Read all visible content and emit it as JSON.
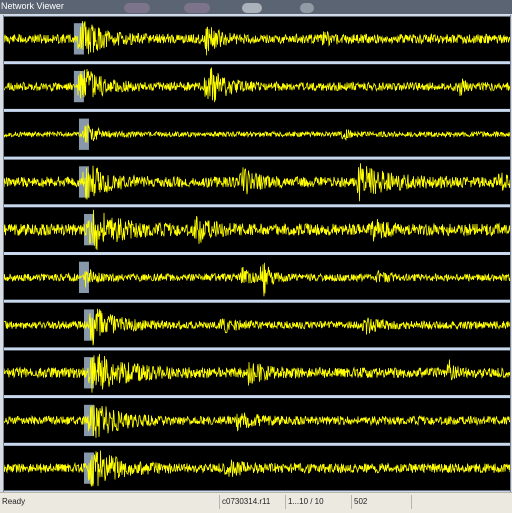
{
  "window": {
    "title": "Network Viewer"
  },
  "status": {
    "left": "Ready",
    "file": "c0730314.r11",
    "range": "1...10 / 10",
    "count": "502"
  },
  "colors": {
    "trace": "#ffff00",
    "panel_bg": "#000000",
    "separator": "#c8d8ee",
    "highlight": "#9fb3c8"
  },
  "chart_data": {
    "type": "line",
    "description": "10 stacked seismogram channels, each a noisy waveform with an arrival burst near the left",
    "channels": [
      {
        "amp": 0.22,
        "seed": 11,
        "bursts": [
          [
            0.15,
            1.0,
            0.03
          ],
          [
            0.4,
            0.7,
            0.015
          ],
          [
            0.63,
            0.25,
            0.01
          ]
        ]
      },
      {
        "amp": 0.2,
        "seed": 23,
        "bursts": [
          [
            0.15,
            1.0,
            0.03
          ],
          [
            0.4,
            1.0,
            0.025
          ],
          [
            0.9,
            0.35,
            0.004
          ]
        ]
      },
      {
        "amp": 0.12,
        "seed": 37,
        "bursts": [
          [
            0.16,
            0.6,
            0.015
          ],
          [
            0.67,
            0.3,
            0.006
          ]
        ]
      },
      {
        "amp": 0.25,
        "seed": 41,
        "bursts": [
          [
            0.16,
            0.9,
            0.03
          ],
          [
            0.47,
            0.5,
            0.02
          ],
          [
            0.7,
            0.7,
            0.05
          ],
          [
            0.98,
            0.3,
            0.01
          ]
        ]
      },
      {
        "amp": 0.28,
        "seed": 53,
        "bursts": [
          [
            0.17,
            1.0,
            0.04
          ],
          [
            0.38,
            0.5,
            0.02
          ],
          [
            0.73,
            0.5,
            0.015
          ]
        ]
      },
      {
        "amp": 0.18,
        "seed": 61,
        "bursts": [
          [
            0.16,
            0.5,
            0.008
          ],
          [
            0.47,
            0.4,
            0.008
          ],
          [
            0.51,
            1.0,
            0.006
          ],
          [
            0.74,
            0.3,
            0.005
          ]
        ]
      },
      {
        "amp": 0.18,
        "seed": 71,
        "bursts": [
          [
            0.17,
            1.0,
            0.035
          ],
          [
            0.43,
            0.3,
            0.02
          ],
          [
            0.71,
            0.35,
            0.02
          ]
        ]
      },
      {
        "amp": 0.24,
        "seed": 83,
        "bursts": [
          [
            0.17,
            1.0,
            0.05
          ],
          [
            0.48,
            0.4,
            0.03
          ],
          [
            0.88,
            0.4,
            0.008
          ]
        ]
      },
      {
        "amp": 0.2,
        "seed": 97,
        "bursts": [
          [
            0.17,
            1.0,
            0.04
          ],
          [
            0.46,
            0.3,
            0.03
          ]
        ]
      },
      {
        "amp": 0.22,
        "seed": 101,
        "bursts": [
          [
            0.17,
            1.0,
            0.04
          ],
          [
            0.44,
            0.3,
            0.025
          ]
        ]
      }
    ]
  }
}
